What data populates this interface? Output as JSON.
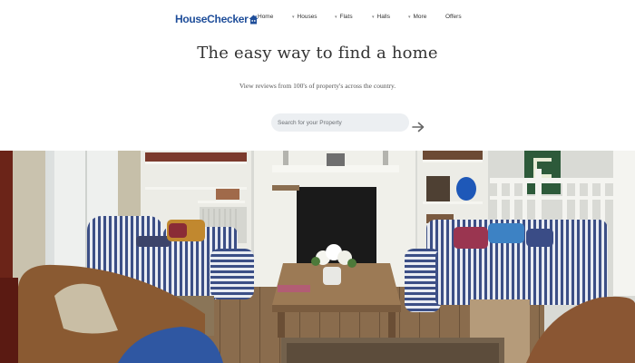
{
  "brand": {
    "name": "HouseChecker",
    "logo_icon": "house-icon",
    "color": "#1f4e9a"
  },
  "nav": {
    "items": [
      {
        "label": "Home",
        "has_dropdown": false
      },
      {
        "label": "Houses",
        "has_dropdown": true
      },
      {
        "label": "Flats",
        "has_dropdown": true
      },
      {
        "label": "Halls",
        "has_dropdown": true
      },
      {
        "label": "More",
        "has_dropdown": true
      },
      {
        "label": "Offers",
        "has_dropdown": false
      }
    ]
  },
  "hero": {
    "title": "The easy way to find a home",
    "subtitle": "View reviews from 100's of property's across the country.",
    "search": {
      "placeholder": "Search for your Property",
      "value": ""
    },
    "submit_icon": "arrow-right-icon"
  },
  "colors": {
    "search_bg": "#eceff2",
    "text": "#333333"
  }
}
